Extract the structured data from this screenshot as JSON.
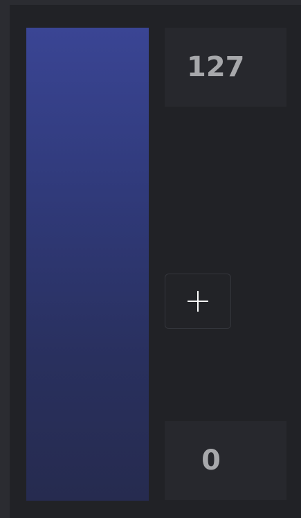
{
  "range": {
    "max_value": "127",
    "min_value": "0"
  },
  "gradient": {
    "top_color": "#3a4594",
    "bottom_color": "#262b4f"
  },
  "controls": {
    "add_icon": "plus-icon"
  }
}
